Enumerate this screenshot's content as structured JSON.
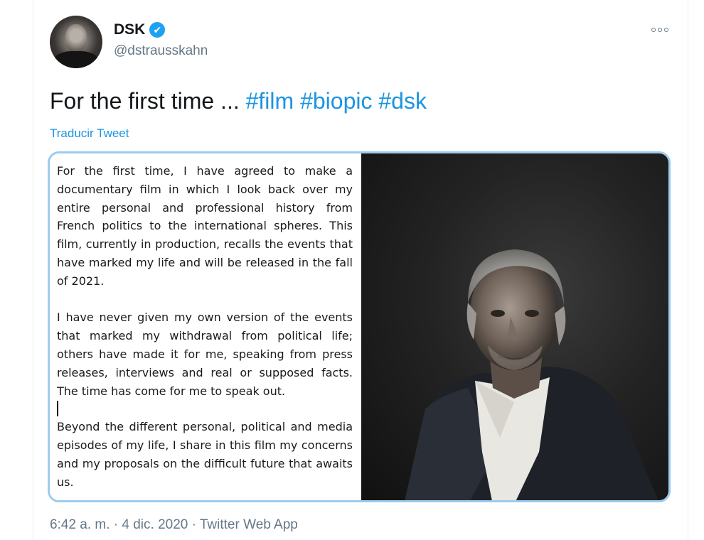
{
  "author": {
    "name": "DSK",
    "verified_mark": "✔",
    "handle": "@dstrausskahn"
  },
  "tweet": {
    "text_plain": "For the first time ... ",
    "hashtags": [
      "#film",
      "#biopic",
      "#dsk"
    ],
    "translate_link": "Traducir Tweet"
  },
  "media": {
    "doc_paragraphs": [
      "For the first time, I have agreed to make a documentary film in which I look back over my entire personal and professional history from French politics to the international spheres. This film, currently in production, recalls the events that have marked my life and will be released in the fall of 2021.",
      "I have never given my own version of the events that marked my withdrawal from political life; others have made it for me, speaking from press releases, interviews and real or supposed facts. The time has come for me to speak out.",
      "Beyond the different personal, political and media episodes of my life, I share in this film my concerns and my proposals on the difficult future that awaits us."
    ]
  },
  "meta": {
    "footer_partial": "6:42 a. m. · 4 dic. 2020 · Twitter Web App"
  },
  "icons": {
    "more": "more-options-icon",
    "verified": "verified-badge-icon"
  },
  "colors": {
    "link": "#1b95e0",
    "verified": "#1da1f2",
    "media_border": "#9ccbee",
    "secondary_text": "#657786"
  }
}
